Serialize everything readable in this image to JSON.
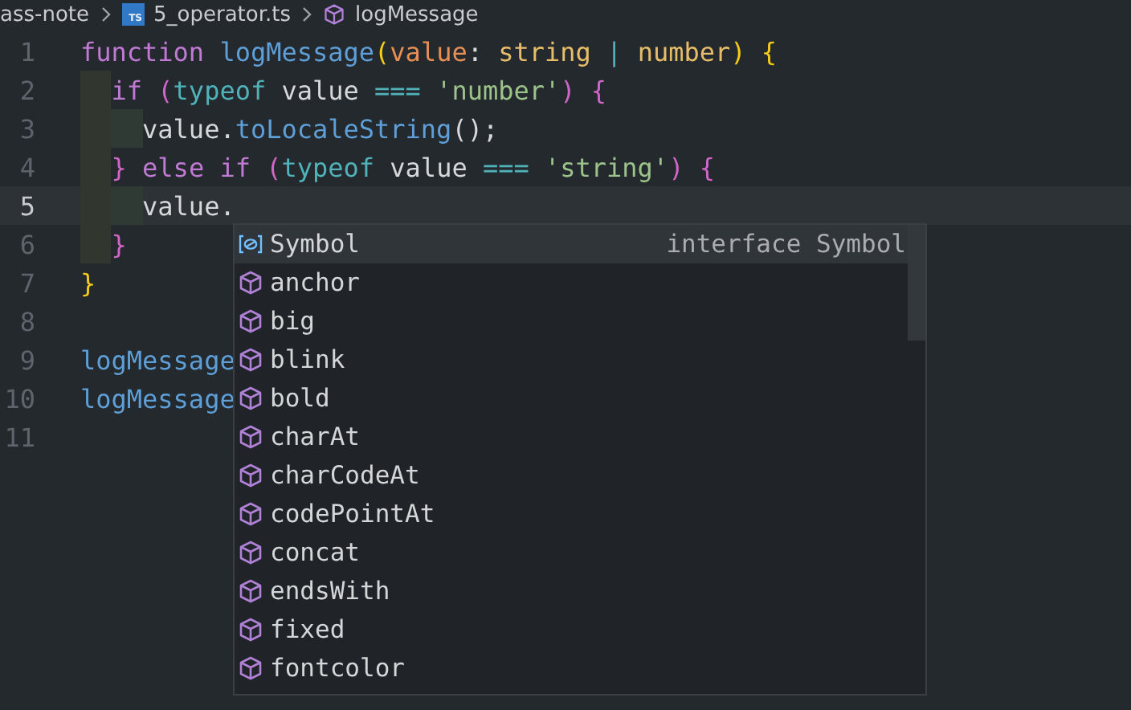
{
  "breadcrumb": [
    {
      "kind": "folder",
      "label": "ass-note"
    },
    {
      "kind": "file",
      "badge": "TS",
      "label": "5_operator.ts"
    },
    {
      "kind": "symbol",
      "label": "logMessage"
    }
  ],
  "editor": {
    "lines": [
      {
        "number": "1",
        "current": false,
        "tokens": [
          {
            "text": "function",
            "kind": "keyword"
          },
          {
            "text": " logMessage",
            "kind": "fn"
          },
          {
            "text": "(",
            "kind": "brace1"
          },
          {
            "text": "value",
            "kind": "param"
          },
          {
            "text": ":",
            "kind": "plain"
          },
          {
            "text": " string",
            "kind": "type"
          },
          {
            "text": " |",
            "kind": "op"
          },
          {
            "text": " number",
            "kind": "type"
          },
          {
            "text": ")",
            "kind": "brace1"
          },
          {
            "text": " {",
            "kind": "brace1"
          }
        ]
      },
      {
        "number": "2",
        "current": false,
        "tokens": [
          {
            "text": "  if",
            "kind": "keyword"
          },
          {
            "text": " (",
            "kind": "brace2"
          },
          {
            "text": "typeof",
            "kind": "op"
          },
          {
            "text": " value",
            "kind": "plain"
          },
          {
            "text": " ===",
            "kind": "op"
          },
          {
            "text": " 'number'",
            "kind": "string"
          },
          {
            "text": ")",
            "kind": "brace2"
          },
          {
            "text": " {",
            "kind": "brace2"
          }
        ]
      },
      {
        "number": "3",
        "current": false,
        "tokens": [
          {
            "text": "    value.",
            "kind": "plain"
          },
          {
            "text": "toLocaleString",
            "kind": "fn"
          },
          {
            "text": "();",
            "kind": "plain"
          }
        ]
      },
      {
        "number": "4",
        "current": false,
        "tokens": [
          {
            "text": "  }",
            "kind": "brace2"
          },
          {
            "text": " else if",
            "kind": "keyword"
          },
          {
            "text": " (",
            "kind": "brace2"
          },
          {
            "text": "typeof",
            "kind": "op"
          },
          {
            "text": " value",
            "kind": "plain"
          },
          {
            "text": " ===",
            "kind": "op"
          },
          {
            "text": " 'string'",
            "kind": "string"
          },
          {
            "text": ")",
            "kind": "brace2"
          },
          {
            "text": " {",
            "kind": "brace2"
          }
        ]
      },
      {
        "number": "5",
        "current": true,
        "tokens": [
          {
            "text": "    value.",
            "kind": "plain"
          }
        ]
      },
      {
        "number": "6",
        "current": false,
        "tokens": [
          {
            "text": "  }",
            "kind": "brace2"
          }
        ]
      },
      {
        "number": "7",
        "current": false,
        "tokens": [
          {
            "text": "}",
            "kind": "brace1"
          }
        ]
      },
      {
        "number": "8",
        "current": false
      },
      {
        "number": "9",
        "current": false,
        "tokens": [
          {
            "text": "logMessage",
            "kind": "fn"
          }
        ]
      },
      {
        "number": "10",
        "current": false,
        "tokens": [
          {
            "text": "logMessage",
            "kind": "fn"
          }
        ]
      },
      {
        "number": "11",
        "current": false
      }
    ]
  },
  "suggestions": {
    "items": [
      {
        "kind": "interface",
        "label": "Symbol",
        "detail": "interface Symbol",
        "selected": true
      },
      {
        "kind": "method",
        "label": "anchor",
        "selected": false
      },
      {
        "kind": "method",
        "label": "big",
        "selected": false
      },
      {
        "kind": "method",
        "label": "blink",
        "selected": false
      },
      {
        "kind": "method",
        "label": "bold",
        "selected": false
      },
      {
        "kind": "method",
        "label": "charAt",
        "selected": false
      },
      {
        "kind": "method",
        "label": "charCodeAt",
        "selected": false
      },
      {
        "kind": "method",
        "label": "codePointAt",
        "selected": false
      },
      {
        "kind": "method",
        "label": "concat",
        "selected": false
      },
      {
        "kind": "method",
        "label": "endsWith",
        "selected": false
      },
      {
        "kind": "method",
        "label": "fixed",
        "selected": false
      },
      {
        "kind": "method",
        "label": "fontcolor",
        "selected": false
      }
    ]
  }
}
